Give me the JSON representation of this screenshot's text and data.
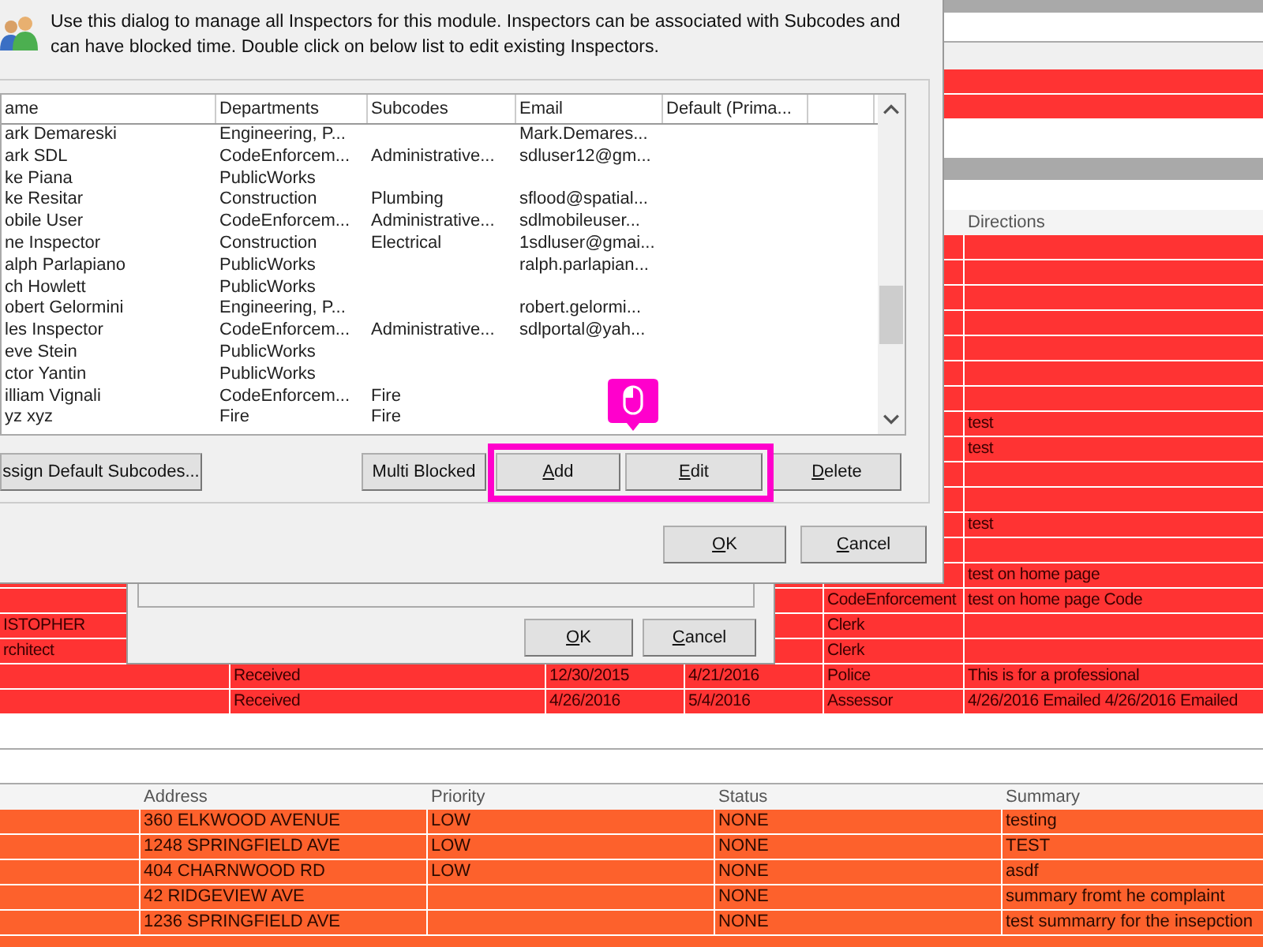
{
  "background_table": {
    "header": {
      "directions": "Directions"
    },
    "rows": [
      {},
      {},
      {},
      {},
      {},
      {},
      {},
      {
        "directions": "test"
      },
      {
        "directions": "test"
      },
      {},
      {},
      {
        "directions": "test"
      },
      {},
      {
        "directions": "test on home page"
      },
      {
        "column_5": "CodeEnforcement",
        "directions": "test on home page Code"
      },
      {
        "column_1": "ISTOPHER",
        "column_5": "Clerk"
      },
      {
        "column_1": "rchitect",
        "column_5": "Clerk"
      },
      {
        "column_2": "Received",
        "column_3": "12/30/2015",
        "column_4": "4/21/2016",
        "column_5": "Police",
        "directions": "This is for a professional"
      },
      {
        "column_2": "Received",
        "column_3": "4/26/2016",
        "column_4": "5/4/2016",
        "column_5": "Assessor",
        "directions": "4/26/2016 Emailed 4/26/2016 Emailed"
      }
    ]
  },
  "lower_table": {
    "columns": {
      "address": "Address",
      "priority": "Priority",
      "status": "Status",
      "summary": "Summary"
    },
    "rows": [
      {
        "address": "360 ELKWOOD AVENUE",
        "priority": "LOW",
        "status": "NONE",
        "summary": "testing"
      },
      {
        "address": "1248 SPRINGFIELD AVE",
        "priority": "LOW",
        "status": "NONE",
        "summary": "TEST"
      },
      {
        "address": "404 CHARNWOOD RD",
        "priority": "LOW",
        "status": "NONE",
        "summary": "asdf"
      },
      {
        "address": "42 RIDGEVIEW AVE",
        "status": "NONE",
        "summary": "summary fromt he complaint"
      },
      {
        "address": "1236 SPRINGFIELD AVE",
        "status": "NONE",
        "summary": "test summarry for the insepction"
      }
    ]
  },
  "back_dialog": {
    "buttons": [
      {
        "label": "OK",
        "mnemonic": true
      },
      {
        "label": "Cancel",
        "mnemonic": true
      }
    ]
  },
  "dialog": {
    "description": "Use this dialog to manage all Inspectors for this module. Inspectors can be associated with Subcodes and can have blocked time. Double click on  below list to edit existing Inspectors.",
    "list": {
      "columns": [
        "ame",
        "Departments",
        "Subcodes",
        "Email",
        "Default (Prima..."
      ],
      "rows": [
        {
          "name": "ark Demareski",
          "departments": "Engineering, P...",
          "email": "Mark.Demares..."
        },
        {
          "name": "ark SDL",
          "departments": "CodeEnforcem...",
          "subcodes": "Administrative...",
          "email": "sdluser12@gm..."
        },
        {
          "name": "ke Piana",
          "departments": "PublicWorks"
        },
        {
          "name": "ke Resitar",
          "departments": "Construction",
          "subcodes": "Plumbing",
          "email": "sflood@spatial..."
        },
        {
          "name": "obile User",
          "departments": "CodeEnforcem...",
          "subcodes": "Administrative...",
          "email": "sdlmobileuser..."
        },
        {
          "name": "ne Inspector",
          "departments": "Construction",
          "subcodes": "Electrical",
          "email": "1sdluser@gmai..."
        },
        {
          "name": "alph Parlapiano",
          "departments": "PublicWorks",
          "email": "ralph.parlapian..."
        },
        {
          "name": "ch  Howlett",
          "departments": "PublicWorks"
        },
        {
          "name": "obert  Gelormini",
          "departments": "Engineering, P...",
          "email": "robert.gelormi..."
        },
        {
          "name": "les Inspector",
          "departments": "CodeEnforcem...",
          "subcodes": "Administrative...",
          "email": "sdlportal@yah..."
        },
        {
          "name": "eve Stein",
          "departments": "PublicWorks"
        },
        {
          "name": "ctor  Yantin",
          "departments": "PublicWorks"
        },
        {
          "name": "illiam Vignali",
          "departments": "CodeEnforcem...",
          "subcodes": "Fire"
        },
        {
          "name": "yz xyz",
          "departments": "Fire",
          "subcodes": "Fire"
        }
      ]
    },
    "buttons": [
      {
        "label": "ssign Default Subcodes...",
        "mnemonic": false
      },
      {
        "label": "Multi Blocked",
        "mnemonic": false
      },
      {
        "label": "Add",
        "mnemonic": true
      },
      {
        "label": "Edit",
        "mnemonic": true
      },
      {
        "label": "Delete",
        "mnemonic": true
      }
    ],
    "footer_buttons": [
      {
        "label": "OK",
        "mnemonic": true
      },
      {
        "label": "Cancel",
        "mnemonic": true
      }
    ]
  }
}
